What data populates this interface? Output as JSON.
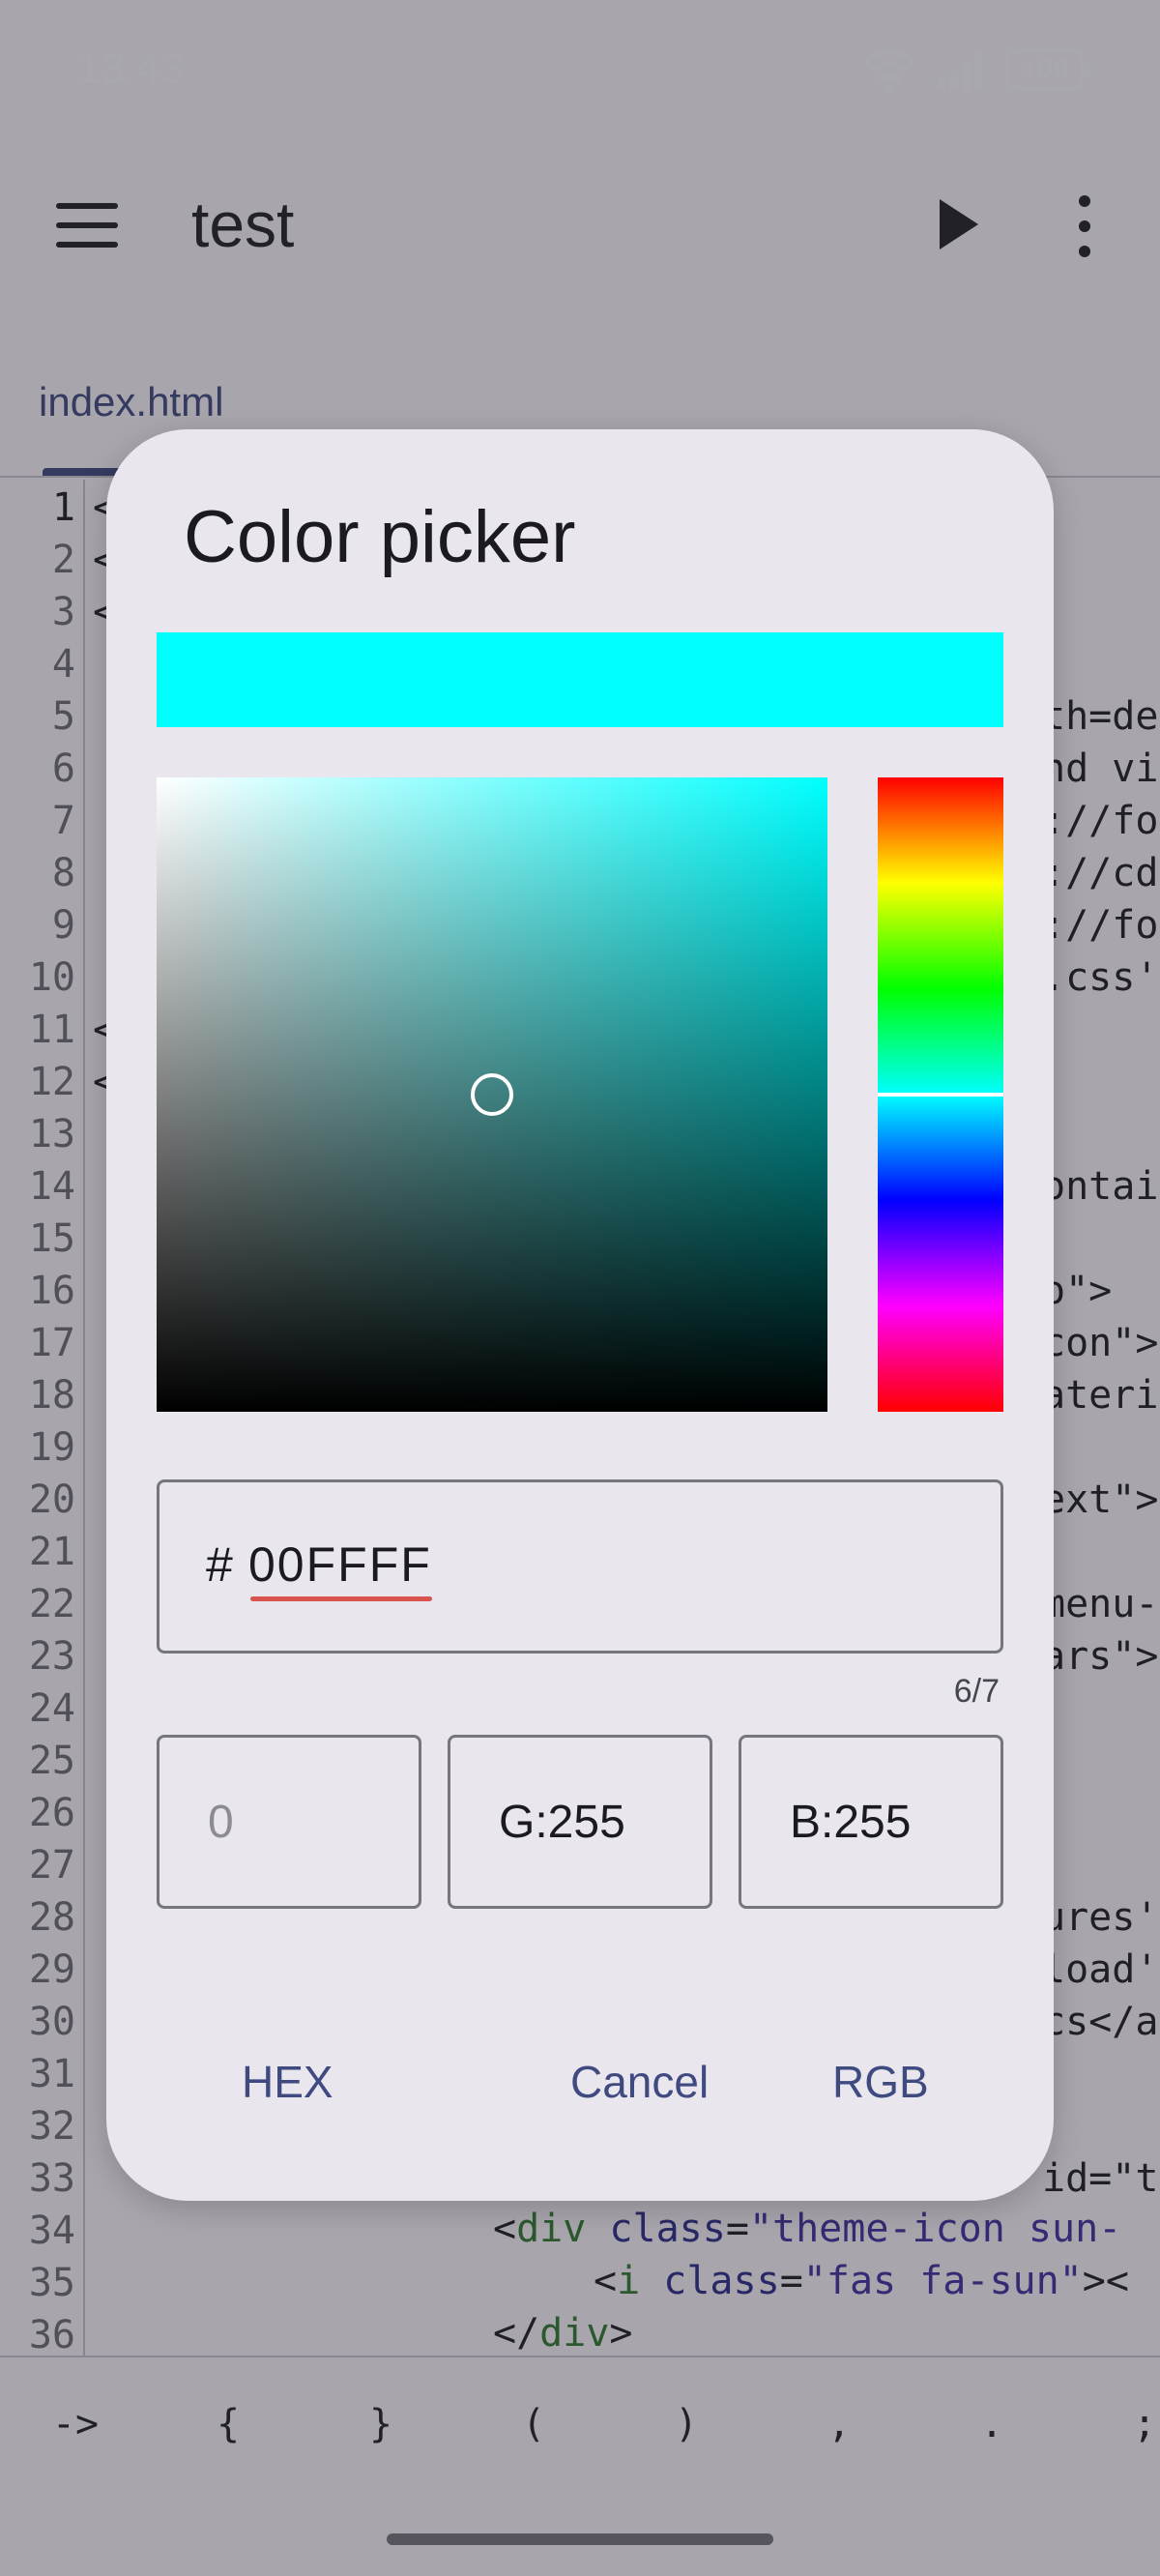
{
  "status_bar": {
    "time": "13:43",
    "battery": "100"
  },
  "app_bar": {
    "title": "test"
  },
  "tabs": [
    {
      "label": "index.html"
    }
  ],
  "editor": {
    "line_numbers": [
      "1",
      "2",
      "3",
      "4",
      "5",
      "6",
      "7",
      "8",
      "9",
      "10",
      "11",
      "12",
      "13",
      "14",
      "15",
      "16",
      "17",
      "18",
      "19",
      "20",
      "21",
      "22",
      "23",
      "24",
      "25",
      "26",
      "27",
      "28",
      "29",
      "30",
      "31",
      "32",
      "33",
      "34",
      "35",
      "36"
    ],
    "code_fragments": [
      {
        "line": 1,
        "text": "<"
      },
      {
        "line": 2,
        "text": "<"
      },
      {
        "line": 3,
        "text": "<"
      },
      {
        "line": 5,
        "text": "th=de"
      },
      {
        "line": 6,
        "text": "nd vi"
      },
      {
        "line": 7,
        "text": "://fo"
      },
      {
        "line": 8,
        "text": "://cd"
      },
      {
        "line": 9,
        "text": "://fo"
      },
      {
        "line": 10,
        "text": ".css'"
      },
      {
        "line": 11,
        "text": "<"
      },
      {
        "line": 12,
        "text": "<"
      },
      {
        "line": 14,
        "text": "ontai"
      },
      {
        "line": 16,
        "text": "o\">"
      },
      {
        "line": 17,
        "text": "con\">"
      },
      {
        "line": 18,
        "text": "ateri"
      },
      {
        "line": 20,
        "text": "ext\">"
      },
      {
        "line": 22,
        "text": "menu-"
      },
      {
        "line": 23,
        "text": "ars\">"
      },
      {
        "line": 28,
        "text": "ures'"
      },
      {
        "line": 29,
        "text": "load'"
      },
      {
        "line": 30,
        "text": "cs</a"
      },
      {
        "line": 33,
        "text": "id=\"t"
      }
    ],
    "line_34": {
      "open": "<",
      "tag": "div",
      "attr": " class",
      "eq": "=",
      "str": "\"theme-icon sun-"
    },
    "line_35": {
      "open": "<",
      "tag": "i",
      "attr": " class",
      "eq": "=",
      "str": "\"fas fa-sun\"",
      "close": "><"
    },
    "line_36": {
      "open": "</",
      "tag": "div",
      "close": ">"
    }
  },
  "symbols": [
    "->",
    "{",
    "}",
    "(",
    ")",
    ",",
    ".",
    ";"
  ],
  "dialog": {
    "title": "Color picker",
    "selected_color": "#00FFFF",
    "hue_color": "#00FFFF",
    "hue_deg": 180,
    "sv_cursor": {
      "saturation": 0.5,
      "value": 0.5
    },
    "hex_field": {
      "prefix": "#",
      "value": "00FFFF",
      "counter": "6/7"
    },
    "rgb_fields": {
      "r": {
        "placeholder": "0"
      },
      "g": {
        "label": "G:",
        "value": "255"
      },
      "b": {
        "label": "B:",
        "value": "255"
      }
    },
    "buttons": {
      "hex": "HEX",
      "cancel": "Cancel",
      "rgb": "RGB"
    }
  },
  "colors": {
    "accent": "#3F4A80",
    "scrim": "rgba(40,38,48,0.40)",
    "dialog_bg": "#E9E6EE",
    "spell_underline": "#D9534F"
  }
}
